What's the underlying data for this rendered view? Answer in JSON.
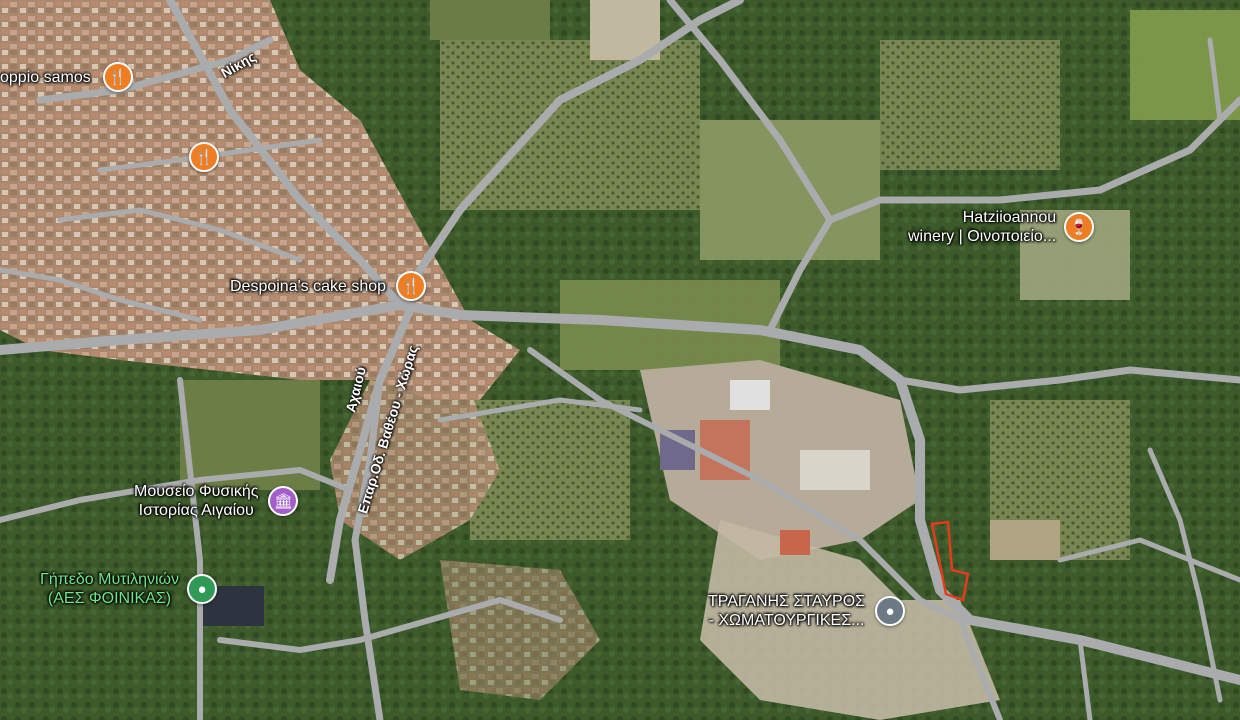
{
  "map": {
    "colors": {
      "terrain": "#4f6a3a",
      "town": "#a88970",
      "road": "#a9abad",
      "parcel_outline": "#e53a1e",
      "restaurant_pin": "#ef7d22",
      "museum_pin": "#a35ec9",
      "stadium_pin": "#2e9a55",
      "place_pin": "#6c7a86"
    },
    "pois": [
      {
        "id": "oppio",
        "label": "oppio samos",
        "icon": "fork-knife-icon"
      },
      {
        "id": "restaurant2",
        "label": "",
        "icon": "fork-knife-icon"
      },
      {
        "id": "despoina",
        "label": "Despoina's cake shop",
        "icon": "fork-knife-icon"
      },
      {
        "id": "hatzi",
        "label_line1": "Hatziioannou",
        "label_line2": "winery | Οινοποιείο...",
        "icon": "wine-glass-icon"
      },
      {
        "id": "museum",
        "label_line1": "Μουσείο Φυσικής",
        "label_line2": "Ιστορίας Αιγαίου",
        "icon": "museum-icon"
      },
      {
        "id": "stadium",
        "label_line1": "Γήπεδο Μυτιληνιών",
        "label_line2": "(ΑΕΣ ΦΟΙΝΙΚΑΣ)",
        "icon": "stadium-pin-icon"
      },
      {
        "id": "tragani",
        "label_line1": "ΤΡΑΓΑΝΗΣ ΣΤΑΥΡΟΣ",
        "label_line2": "- ΧΩΜΑΤΟΥΡΓΙΚΕΣ...",
        "icon": "place-pin-icon"
      }
    ],
    "road_labels": {
      "nikis": "Νίκης",
      "achaiou": "Αχαιού",
      "eparchiaki": "Επαρ.Οδ. Βαθέου - Χώρας"
    }
  }
}
